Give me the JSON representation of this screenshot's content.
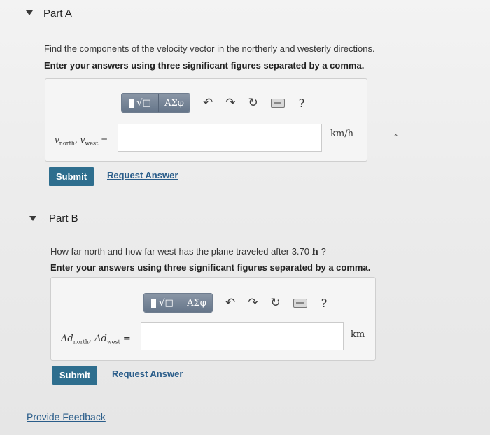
{
  "part_a": {
    "title": "Part A",
    "question": "Find the components of the velocity vector in the northerly and westerly directions.",
    "instruction": "Enter your answers using three significant figures separated by a comma.",
    "toolbar": {
      "templates_label": "√□",
      "greek_label": "ΑΣφ",
      "help_label": "?"
    },
    "answer_label_var1": "v",
    "answer_label_sub1": "north",
    "answer_label_sep": ", ",
    "answer_label_var2": "v",
    "answer_label_sub2": "west",
    "answer_label_eq": " =",
    "answer_value": "",
    "unit": "km/h",
    "submit_label": "Submit",
    "request_label": "Request Answer"
  },
  "part_b": {
    "title": "Part B",
    "question_prefix": "How far north and how far west has the plane traveled after 3.70 ",
    "question_unit": "h",
    "question_suffix": " ?",
    "instruction": "Enter your answers using three significant figures separated by a comma.",
    "toolbar": {
      "templates_label": "√□",
      "greek_label": "ΑΣφ",
      "help_label": "?"
    },
    "answer_label_var1": "Δd",
    "answer_label_sub1": "north",
    "answer_label_sep": ", ",
    "answer_label_var2": "Δd",
    "answer_label_sub2": "west",
    "answer_label_eq": " =",
    "answer_value": "",
    "unit": "km",
    "submit_label": "Submit",
    "request_label": "Request Answer"
  },
  "feedback_label": "Provide Feedback",
  "colors": {
    "submit": "#2e6e8e",
    "link": "#2a5d8a",
    "toolbar": "#7a8799"
  },
  "icons": [
    "collapse-triangle-icon",
    "undo-icon",
    "redo-icon",
    "reset-icon",
    "keyboard-icon",
    "help-icon"
  ]
}
